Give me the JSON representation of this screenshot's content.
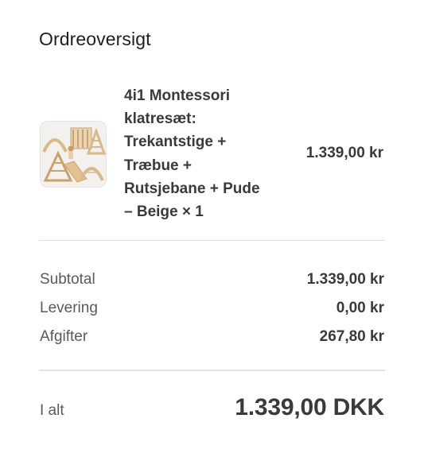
{
  "summary": {
    "title": "Ordreoversigt"
  },
  "product": {
    "image_icon": "climbing-set-product-image",
    "name_lines": [
      "4i1 Montessori",
      "klatresæt:",
      "Trekantstige +",
      "Træbue +",
      "Rutsjebane + Pude",
      "– Beige × 1"
    ],
    "price": "1.339,00 kr"
  },
  "costs": {
    "subtotal_label": "Subtotal",
    "subtotal_value": "1.339,00 kr",
    "shipping_label": "Levering",
    "shipping_value": "0,00 kr",
    "taxes_label": "Afgifter",
    "taxes_value": "267,80 kr"
  },
  "total": {
    "label": "I alt",
    "value": "1.339,00 DKK"
  },
  "colors": {
    "text_dark": "#3a3a3a",
    "text_muted": "#5a5a5a",
    "divider": "#dedede",
    "wood": "#d9b98a"
  }
}
